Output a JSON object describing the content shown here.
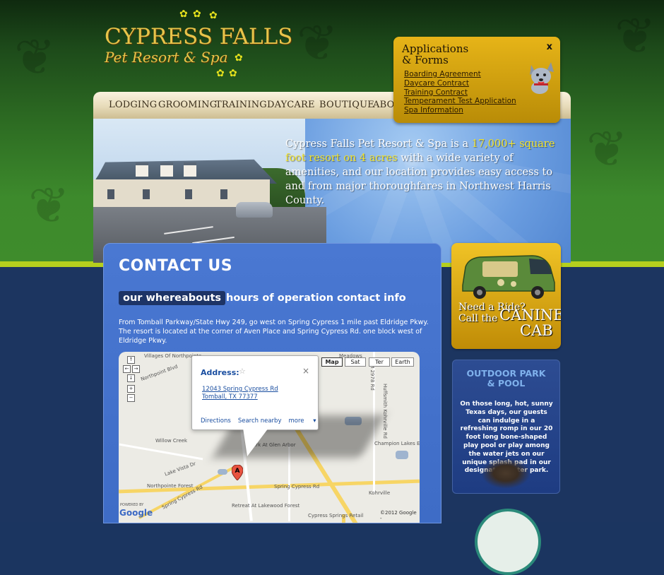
{
  "logo": {
    "title": "CYPRESS FALLS",
    "subtitle": "Pet Resort & Spa"
  },
  "nav": {
    "items": [
      "LODGING",
      "GROOMING",
      "TRAINING",
      "DAYCARE",
      "BOUTIQUE",
      "ABOU"
    ]
  },
  "hero": {
    "text_before": "Cypress Falls Pet Resort & Spa is a ",
    "highlight": "17,000+ square foot resort on 4 acres",
    "text_after": " with a wide variety of amenities, and our location provides easy access to and from major thoroughfares in Northwest Harris County."
  },
  "applications": {
    "title_line1": "Applications",
    "title_line2": "& Forms",
    "close": "x",
    "links": [
      "Boarding Agreement",
      "Daycare Contract",
      "Training Contract",
      "Temperament Test Application",
      "Spa Information"
    ]
  },
  "contact": {
    "title": "CONTACT US",
    "tabs": [
      "our whereabouts",
      "hours of operation",
      "contact info"
    ],
    "directions": "From Tomball Parkway/State Hwy 249, go west on Spring Cypress 1 mile past Eldridge Pkwy. The resort is located at the corner of Aven Place and Spring Cypress Rd. one block west of Eldridge Pkwy."
  },
  "map": {
    "tabs": [
      "Map",
      "Sat",
      "Ter",
      "Earth"
    ],
    "controls": [
      "↑",
      "←",
      "→",
      "↓",
      "+",
      "−"
    ],
    "popup": {
      "title": "Address:",
      "close": "×",
      "address_line1": "12043 Spring Cypress Rd",
      "address_line2": "Tomball, TX 77377",
      "links": [
        "Directions",
        "Search nearby",
        "more"
      ]
    },
    "labels": [
      "Villages Of Northpointe",
      "Willow Creek",
      "Northpointe Forest",
      "Spring Cypress Rd",
      "Spring Cypress Rd",
      "Kohrville",
      "Champion Lakes Estate",
      "Retreat At Lakewood Forest",
      "Cypress Springs Retail",
      "Park At Glen Arbor",
      "Meadows",
      "Lake Vista Dr",
      "Northpoint Blvd",
      "Huffsmith Kohrville Rd",
      "FM 2978 Rd"
    ],
    "marker": "A",
    "powered_by": "POWERED BY",
    "google": "Google",
    "copyright": "©2012 Google -"
  },
  "cab": {
    "line1": "Need a Ride?",
    "line2": "Call the",
    "line3": "CANINE",
    "line4": "CAB"
  },
  "pool": {
    "title_line1": "OUTDOOR PARK",
    "title_line2": "& POOL",
    "text": "On those long, hot, sunny Texas days, our guests can indulge in a refreshing romp in our 20 foot long bone-shaped play pool or play among the water jets on our unique splash pad in our designated water park."
  },
  "colors": {
    "header_green": "#2c6a22",
    "accent_gold": "#e7c44a",
    "lime_stripe": "#b5cf1e",
    "navy": "#1c3560",
    "panel_blue": "#4a78d2",
    "link_blue": "#1a4ea0"
  }
}
